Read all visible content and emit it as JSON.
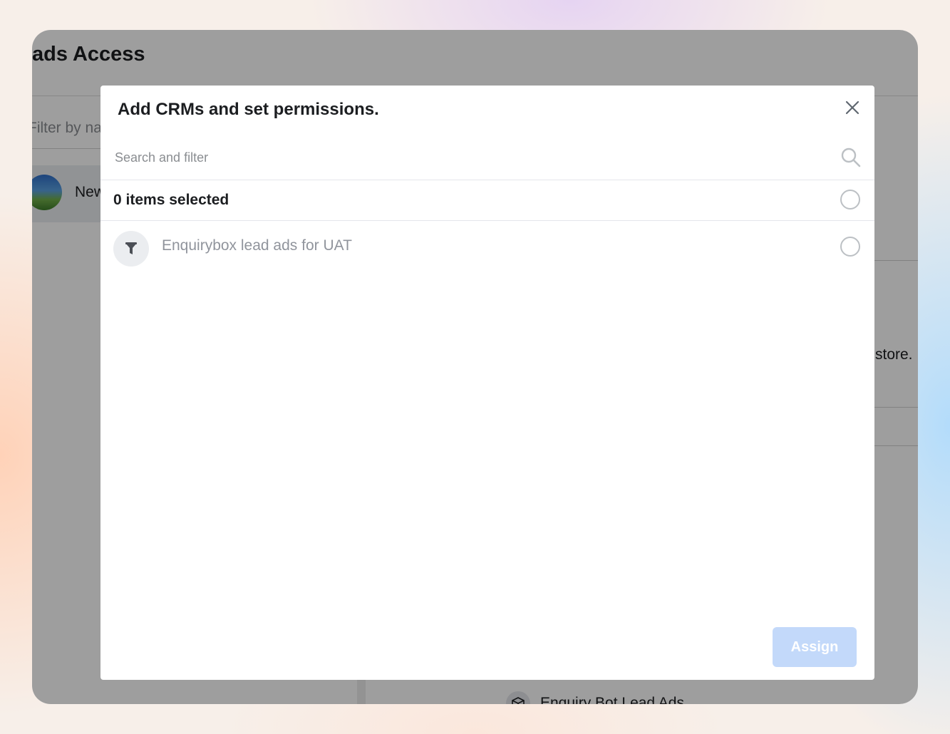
{
  "background_app": {
    "page_title": "ads Access",
    "filter_placeholder": "Filter by na",
    "account_label": "New",
    "store_text": "store.",
    "bot_item_label": "Enquiry Bot Lead Ads"
  },
  "modal": {
    "title": "Add CRMs and set permissions.",
    "search": {
      "placeholder": "Search and filter",
      "value": ""
    },
    "selected_count_label": "0 items selected",
    "items": [
      {
        "label": "Enquirybox lead ads for UAT",
        "icon": "filter-icon",
        "selected": false
      }
    ],
    "assign_label": "Assign"
  },
  "colors": {
    "overlay": "#000000",
    "assign_disabled": "#c3d9fa",
    "text_primary": "#1c1e21",
    "text_muted": "#90949c"
  }
}
